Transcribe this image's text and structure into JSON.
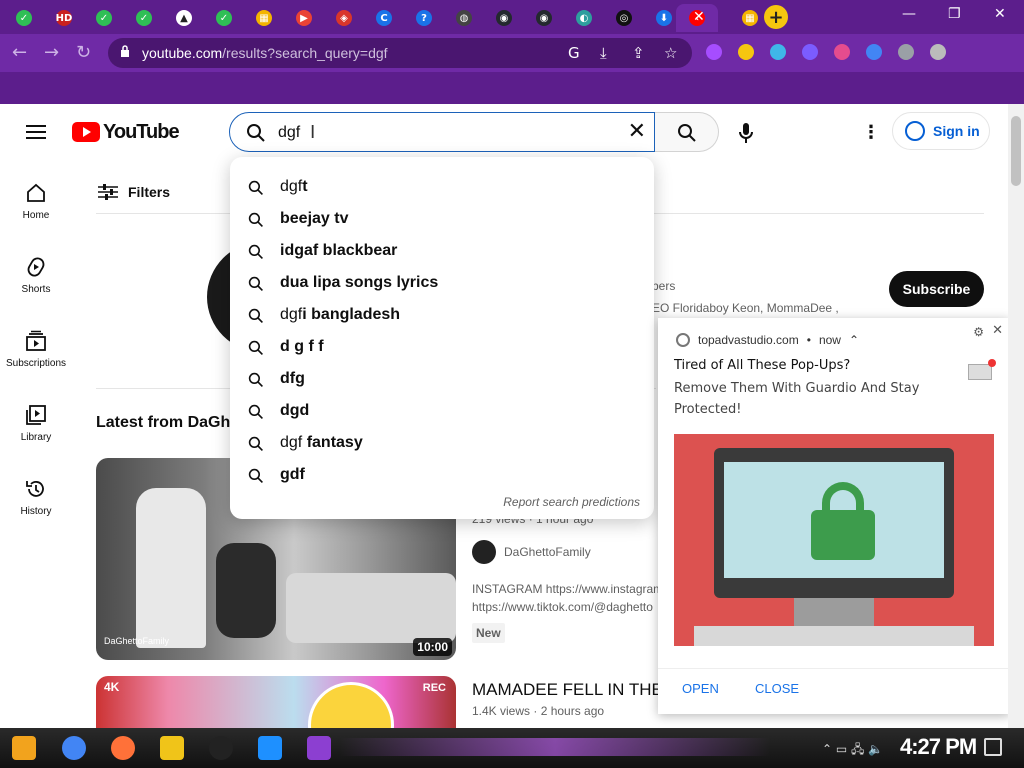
{
  "browser": {
    "tab_close": "✕",
    "new_tab": "+",
    "tab_favicons": [
      {
        "icon": "check-icon",
        "color": "#2fbf56",
        "glyph": "✓"
      },
      {
        "icon": "hd-icon",
        "color": "#c9211e",
        "glyph": "HD"
      },
      {
        "icon": "check-icon",
        "color": "#2fbf56",
        "glyph": "✓"
      },
      {
        "icon": "check-icon",
        "color": "#2fbf56",
        "glyph": "✓"
      },
      {
        "icon": "drive-icon",
        "color": "#ffffff",
        "glyph": "▲"
      },
      {
        "icon": "check-icon",
        "color": "#2fbf56",
        "glyph": "✓"
      },
      {
        "icon": "sheet-icon",
        "color": "#f4b400",
        "glyph": "▦"
      },
      {
        "icon": "play-icon",
        "color": "#ea4335",
        "glyph": "▶"
      },
      {
        "icon": "shield-icon",
        "color": "#d9362b",
        "glyph": "◈"
      },
      {
        "icon": "c-icon",
        "color": "#1a73e8",
        "glyph": "C"
      },
      {
        "icon": "question-icon",
        "color": "#1a73e8",
        "glyph": "?"
      },
      {
        "icon": "globe-icon",
        "color": "#444444",
        "glyph": "◍"
      },
      {
        "icon": "github-icon",
        "color": "#24292f",
        "glyph": "◉"
      },
      {
        "icon": "github-icon",
        "color": "#24292f",
        "glyph": "◉"
      },
      {
        "icon": "edge-icon",
        "color": "#2e9e9e",
        "glyph": "◐"
      },
      {
        "icon": "target-icon",
        "color": "#111111",
        "glyph": "◎"
      },
      {
        "icon": "download-icon",
        "color": "#1a73e8",
        "glyph": "⬇"
      },
      {
        "icon": "youtube-icon",
        "color": "#ff0000",
        "glyph": "‹"
      },
      {
        "icon": "sheet-icon",
        "color": "#f4b400",
        "glyph": "▦"
      }
    ],
    "window_controls": {
      "minimize": "—",
      "maximize": "❐",
      "close": "✕"
    },
    "url_host": "youtube.com",
    "url_path": "/results?search_query=dgf",
    "extension_colors": [
      "#a64dff",
      "#f6c60f",
      "#3fb6e8",
      "#7b5cff",
      "#e54c8e",
      "#4285f4",
      "#9aa0a6",
      "#bbbbbb"
    ]
  },
  "youtube": {
    "logo_text": "YouTube",
    "search": {
      "query": "dgf",
      "clear": "✕"
    },
    "more": "⋮",
    "signin_label": "Sign in",
    "guide": [
      {
        "label": "Home",
        "icon": "home-icon"
      },
      {
        "label": "Shorts",
        "icon": "shorts-icon"
      },
      {
        "label": "Subscriptions",
        "icon": "subscriptions-icon"
      },
      {
        "label": "Library",
        "icon": "library-icon"
      },
      {
        "label": "History",
        "icon": "history-icon"
      }
    ],
    "filters_label": "Filters",
    "channel": {
      "fragment_1": "bers",
      "fragment_2": "EO Floridaboy Keon, MommaDee ,",
      "subscribe_label": "Subscribe"
    },
    "latest_label": "Latest from DaGhe",
    "video1": {
      "duration": "10:00",
      "thumb_brand": "DaGhettoFamily",
      "meta": "219 views · 1 hour ago",
      "channel_name": "DaGhettoFamily",
      "desc_line1": "INSTAGRAM https://www.instagram",
      "desc_line2": "https://www.tiktok.com/@daghetto",
      "badge": "New"
    },
    "video2": {
      "title": "MAMADEE FELL IN THE",
      "meta": "1.4K views · 2 hours ago",
      "thumb_left_text": "4K",
      "thumb_right_text": "REC"
    }
  },
  "suggestions": {
    "items": [
      {
        "prefix": "dgf",
        "suffix": "t"
      },
      {
        "prefix": "",
        "suffix": "beejay tv"
      },
      {
        "prefix": "",
        "suffix": "idgaf blackbear"
      },
      {
        "prefix": "",
        "suffix": "dua lipa songs lyrics"
      },
      {
        "prefix": "dgf",
        "suffix": "i bangladesh"
      },
      {
        "prefix": "",
        "suffix": "d g f f"
      },
      {
        "prefix": "",
        "suffix": "dfg"
      },
      {
        "prefix": "",
        "suffix": "dgd"
      },
      {
        "prefix": "dgf",
        "suffix": " fantasy"
      },
      {
        "prefix": "",
        "suffix": "gdf"
      }
    ],
    "report_label": "Report search predictions"
  },
  "notification": {
    "source": "topadvastudio.com",
    "time": "now",
    "title": "Tired of All These Pop-Ups?",
    "body": "Remove Them With Guardio And Stay Protected!",
    "open_label": "OPEN",
    "close_label": "CLOSE"
  },
  "taskbar": {
    "clock": "4:27 PM",
    "app_colors": [
      "#f2a31d",
      "#4285f4",
      "#ff7139",
      "#f0c419",
      "#222222",
      "#1e90ff",
      "#8c3fd1"
    ]
  }
}
